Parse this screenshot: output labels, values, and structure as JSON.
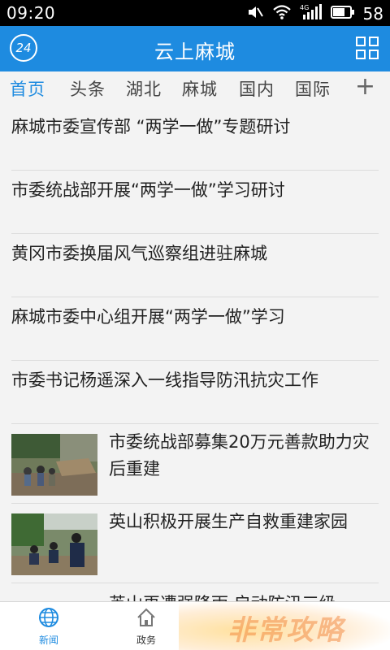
{
  "status_bar": {
    "time": "09:20",
    "network": "4G",
    "battery_level": "58",
    "icons": [
      "mute-icon",
      "wifi-icon",
      "signal-icon",
      "battery-icon"
    ]
  },
  "app_bar": {
    "badge": "24",
    "title": "云上麻城",
    "accent_color": "#1e8be0"
  },
  "tabs": [
    {
      "label": "首页",
      "active": true
    },
    {
      "label": "头条",
      "active": false
    },
    {
      "label": "湖北",
      "active": false
    },
    {
      "label": "麻城",
      "active": false
    },
    {
      "label": "国内",
      "active": false
    },
    {
      "label": "国际",
      "active": false
    }
  ],
  "tab_add_label": "+",
  "text_news": [
    "麻城市委宣传部 “两学一做”专题研讨",
    "市委统战部开展“两学一做”学习研讨",
    "黄冈市委换届风气巡察组进驻麻城",
    "麻城市委中心组开展“两学一做”学习",
    "市委书记杨遥深入一线指导防汛抗灾工作"
  ],
  "image_news": [
    {
      "headline": "市委统战部募集20万元善款助力灾后重建"
    },
    {
      "headline": "英山积极开展生产自救重建家园"
    }
  ],
  "partial_news": "英山再遭强降雨 启动防汛三级",
  "bottom_nav": [
    {
      "label": "新闻",
      "icon": "globe-icon",
      "active": true
    },
    {
      "label": "政务",
      "icon": "home-icon",
      "active": false
    }
  ],
  "watermark": "非常攻略"
}
